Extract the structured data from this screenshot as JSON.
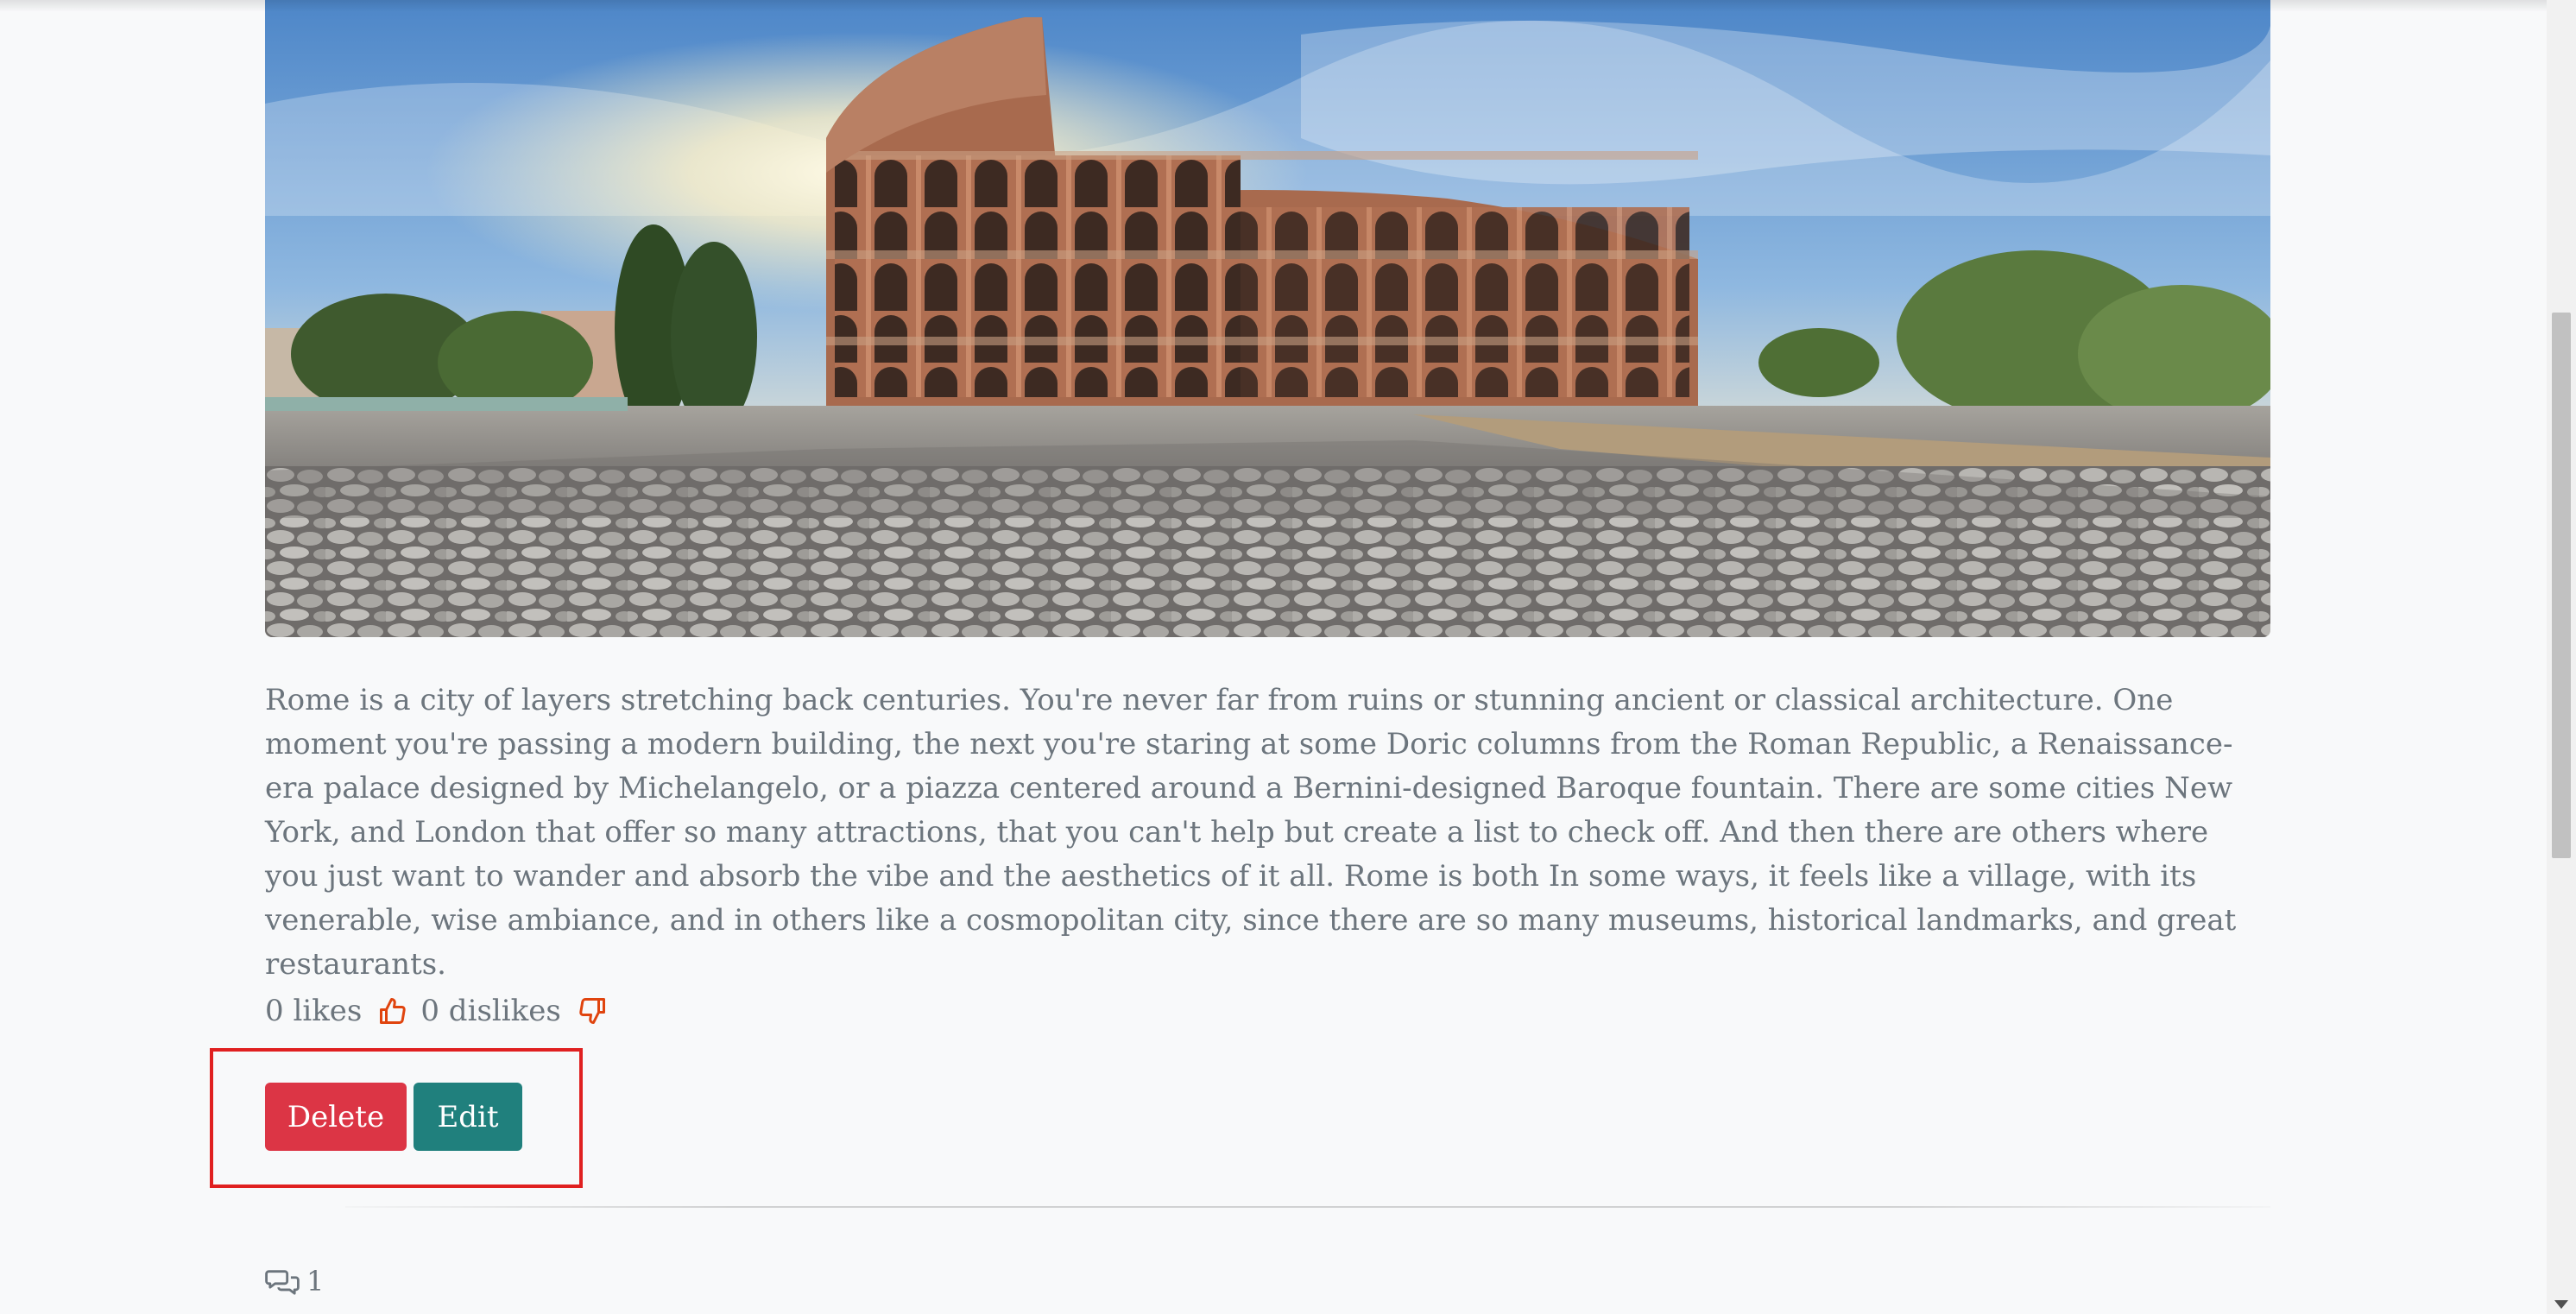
{
  "post": {
    "image": {
      "alt": "Colosseum in Rome at sunrise with cobblestone piazza"
    },
    "description": "Rome is a city of layers stretching back centuries. You're never far from ruins or stunning ancient or classical architecture. One moment you're passing a modern building, the next you're staring at some Doric columns from the Roman Republic, a Renaissance-era palace designed by Michelangelo, or a piazza centered around a Bernini-designed Baroque fountain. There are some cities New York, and London that offer so many attractions, that you can't help but create a list to check off. And then there are others where you just want to wander and absorb the vibe and the aesthetics of it all. Rome is both In some ways, it feels like a village, with its venerable, wise ambiance, and in others like a cosmopolitan city, since there are so many museums, historical landmarks, and great restaurants.",
    "likes_label": "0 likes",
    "dislikes_label": "0 dislikes"
  },
  "actions": {
    "delete_label": "Delete",
    "edit_label": "Edit"
  },
  "comments": {
    "count": "1"
  },
  "colors": {
    "delete": "#dc3545",
    "edit": "#20807d",
    "reaction_icon": "#e0440e",
    "highlight": "#e02020",
    "text": "#6c757d"
  },
  "icons": {
    "like": "thumbs-up-icon",
    "dislike": "thumbs-down-icon",
    "comments": "chat-bubbles-icon"
  }
}
